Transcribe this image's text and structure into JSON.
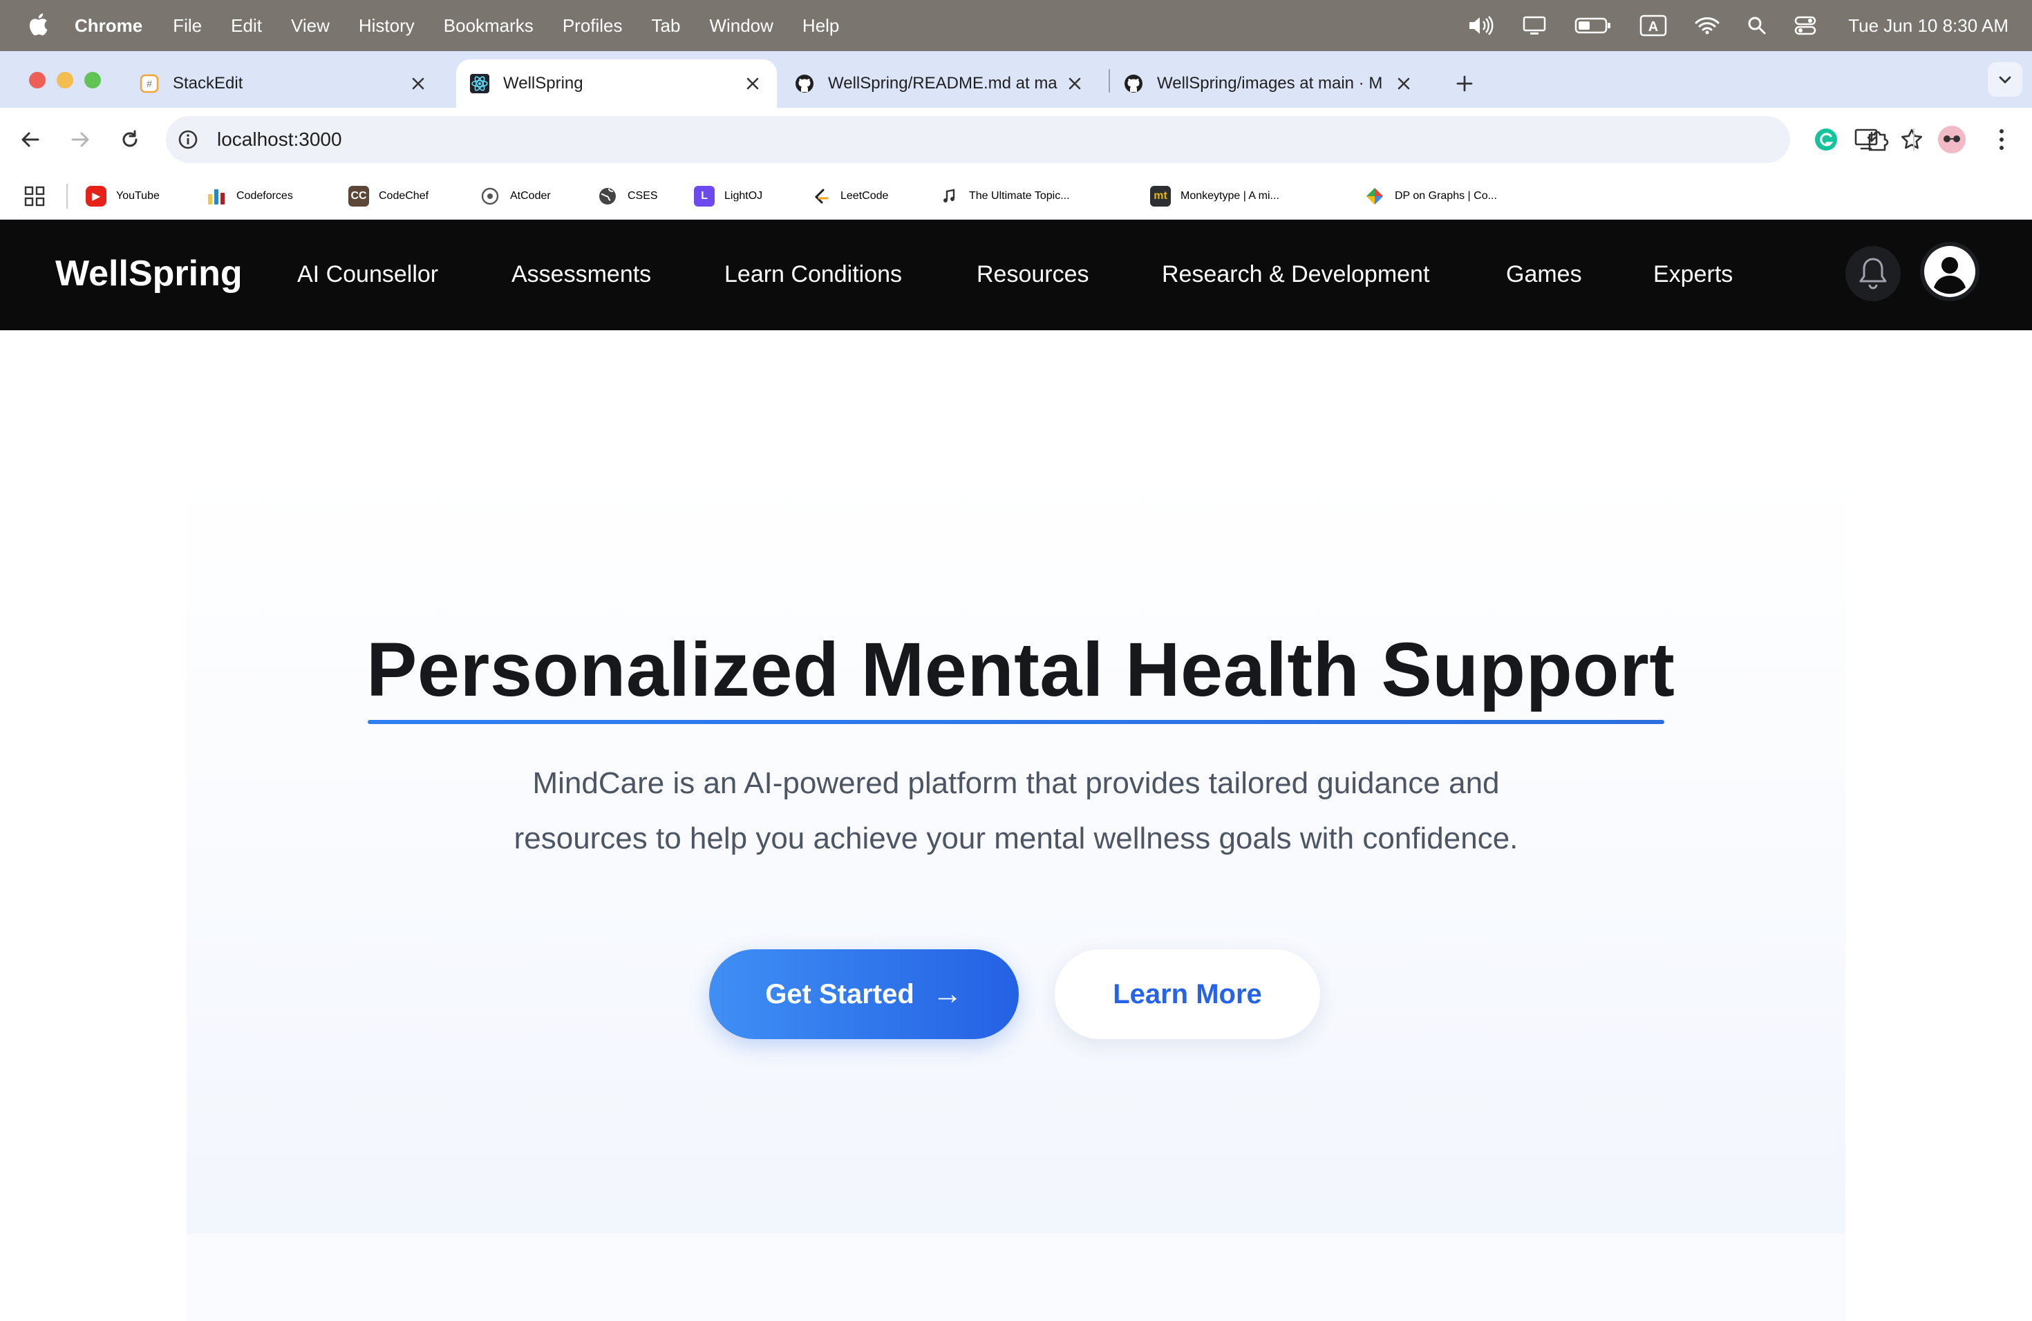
{
  "menubar": {
    "app": "Chrome",
    "items": [
      "File",
      "Edit",
      "View",
      "History",
      "Bookmarks",
      "Profiles",
      "Tab",
      "Window",
      "Help"
    ],
    "clock": "Tue Jun 10  8:30 AM",
    "status_icons": [
      "volume-icon",
      "display-icon",
      "battery-icon",
      "input-source-icon",
      "wifi-icon",
      "spotlight-icon",
      "control-center-icon"
    ]
  },
  "tabs": [
    {
      "title": "StackEdit",
      "favicon": "stackedit-icon"
    },
    {
      "title": "WellSpring",
      "favicon": "react-icon",
      "active": true
    },
    {
      "title": "WellSpring/README.md at ma",
      "favicon": "github-icon"
    },
    {
      "title": "WellSpring/images at main · M",
      "favicon": "github-icon"
    }
  ],
  "address_bar": {
    "url": "localhost:3000"
  },
  "bookmarks": [
    {
      "label": "YouTube",
      "color": "#e62117"
    },
    {
      "label": "Codeforces",
      "color": "#1f8acb"
    },
    {
      "label": "CodeChef",
      "color": "#5b4638"
    },
    {
      "label": "AtCoder",
      "color": "#555555"
    },
    {
      "label": "CSES",
      "color": "#444444"
    },
    {
      "label": "LightOJ",
      "color": "#6d4aed"
    },
    {
      "label": "LeetCode",
      "color": "#f0a322"
    },
    {
      "label": "The Ultimate Topic...",
      "color": "#333333"
    },
    {
      "label": "Monkeytype | A mi...",
      "color": "#2c2e31"
    },
    {
      "label": "DP on Graphs | Co...",
      "color": "#34a853"
    }
  ],
  "site": {
    "brand": "WellSpring",
    "nav": [
      "AI Counsellor",
      "Assessments",
      "Learn Conditions",
      "Resources",
      "Research & Development",
      "Games",
      "Experts"
    ]
  },
  "hero": {
    "title": "Personalized Mental Health Support",
    "subtitle_line1": "MindCare is an AI-powered platform that provides tailored guidance and",
    "subtitle_line2": "resources to help you achieve your mental wellness goals with confidence.",
    "primary_button": "Get Started",
    "primary_arrow": "→",
    "secondary_button": "Learn More"
  },
  "colors": {
    "accent": "#2563eb",
    "navbar": "#0b0b0c",
    "tabstrip": "#dce5f7"
  }
}
